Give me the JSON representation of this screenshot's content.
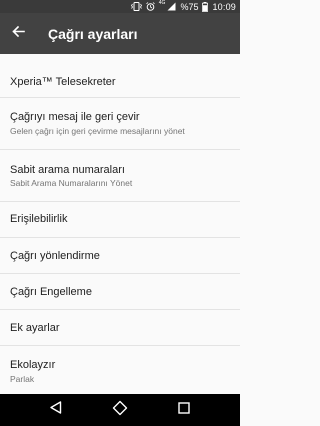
{
  "status_bar": {
    "network_label": "4G",
    "battery_percent": "%75",
    "time": "10:09",
    "icons": [
      "vibrate-icon",
      "alarm-icon",
      "signal-icon",
      "battery-icon"
    ]
  },
  "app_bar": {
    "title": "Çağrı ayarları",
    "back_icon": "arrow-back-icon"
  },
  "settings": [
    {
      "title": "Xperia™ Telesekreter",
      "subtitle": ""
    },
    {
      "title": "Çağrıyı mesaj ile geri çevir",
      "subtitle": "Gelen çağrı için geri çevirme mesajlarını yönet"
    },
    {
      "title": "Sabit arama numaraları",
      "subtitle": "Sabit Arama Numaralarını Yönet"
    },
    {
      "title": "Erişilebilirlik",
      "subtitle": ""
    },
    {
      "title": "Çağrı yönlendirme",
      "subtitle": ""
    },
    {
      "title": "Çağrı Engelleme",
      "subtitle": ""
    },
    {
      "title": "Ek ayarlar",
      "subtitle": ""
    },
    {
      "title": "Ekolayzır",
      "subtitle": "Parlak"
    }
  ],
  "nav_bar": {
    "icons": [
      "back-triangle-icon",
      "home-circle-icon",
      "recents-square-icon"
    ]
  },
  "colors": {
    "status_bar": "#3a3a3a",
    "app_bar": "#424242",
    "background": "#fafafa",
    "nav_bar": "#000000"
  }
}
